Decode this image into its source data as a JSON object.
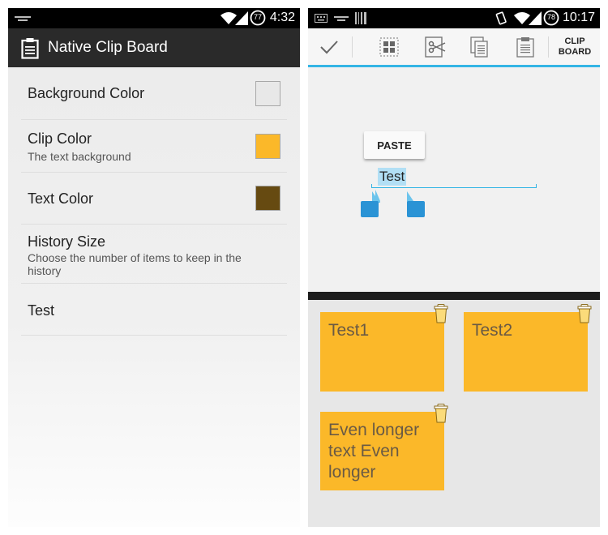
{
  "left_screen": {
    "status_bar": {
      "time": "4:32",
      "battery_level": "77"
    },
    "app_title": "Native Clip Board",
    "preferences": [
      {
        "title": "Background Color",
        "summary": "",
        "swatch_color": "#e8e8e8"
      },
      {
        "title": "Clip Color",
        "summary": "The text background",
        "swatch_color": "#fbb829"
      },
      {
        "title": "Text Color",
        "summary": "",
        "swatch_color": "#664a11"
      },
      {
        "title": "History Size",
        "summary": "Choose the number of items to keep in the history"
      },
      {
        "title": "Test"
      }
    ]
  },
  "right_screen": {
    "status_bar": {
      "time": "10:17",
      "battery_level": "78"
    },
    "toolbar": {
      "clipboard_label_line1": "CLIP",
      "clipboard_label_line2": "BOARD"
    },
    "paste_label": "PASTE",
    "edit_text_value": "Test",
    "clips": [
      {
        "text": "Test1"
      },
      {
        "text": "Test2"
      },
      {
        "text": "Even longer text Even longer"
      }
    ]
  },
  "colors": {
    "accent": "#33b5e5",
    "clip_background": "#fbb829",
    "clip_text": "#6a5a44",
    "action_bar": "#2a2a2a"
  }
}
